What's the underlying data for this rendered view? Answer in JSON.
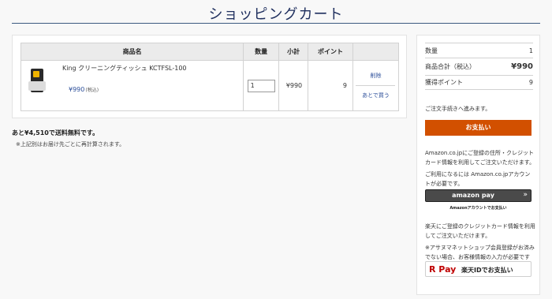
{
  "page": {
    "title": "ショッピングカート"
  },
  "cart": {
    "headers": [
      "商品名",
      "数量",
      "小計",
      "ポイント",
      ""
    ],
    "items": [
      {
        "name": "King クリーニングティッシュ KCTFSL-100",
        "price": "¥990",
        "tax_label": "(税込)",
        "quantity": "1",
        "subtotal": "¥990",
        "points": "9",
        "delete_label": "削除",
        "later_label": "あとで買う"
      }
    ]
  },
  "shipping": {
    "message": "あと¥4,510で送料無料です。",
    "note": "※上記別はお届け先ごとに再計算されます。"
  },
  "summary": {
    "qty_label": "数量",
    "qty_value": "1",
    "total_label": "商品合計（税込）",
    "total_value": "¥990",
    "points_label": "獲得ポイント",
    "points_value": "9"
  },
  "checkout": {
    "proceed_text": "ご注文手続きへ進みます。",
    "pay_button": "お支払い"
  },
  "amazon": {
    "text1": "Amazon.co.jpにご登録の住所・クレジットカード情報を利用してご注文いただけます。",
    "text2": "ご利用になるには Amazon.co.jpアカウントが必要です。",
    "button_logo": "amazon pay",
    "button_arrow": "»",
    "sub": "Amazonアカウントでお支払い"
  },
  "rakuten": {
    "text1": "楽天にご登録のクレジットカード情報を利用してご注文いただけます。",
    "text2": "※アサヌマネットショップ会員登録がお済みでない場合、お客様情報の入力が必要です",
    "logo": "R Pay",
    "button_label": "楽天IDでお支払い"
  },
  "colors": {
    "accent": "#d25000",
    "heading": "#1f2f5e",
    "link": "#2d4f9a"
  }
}
